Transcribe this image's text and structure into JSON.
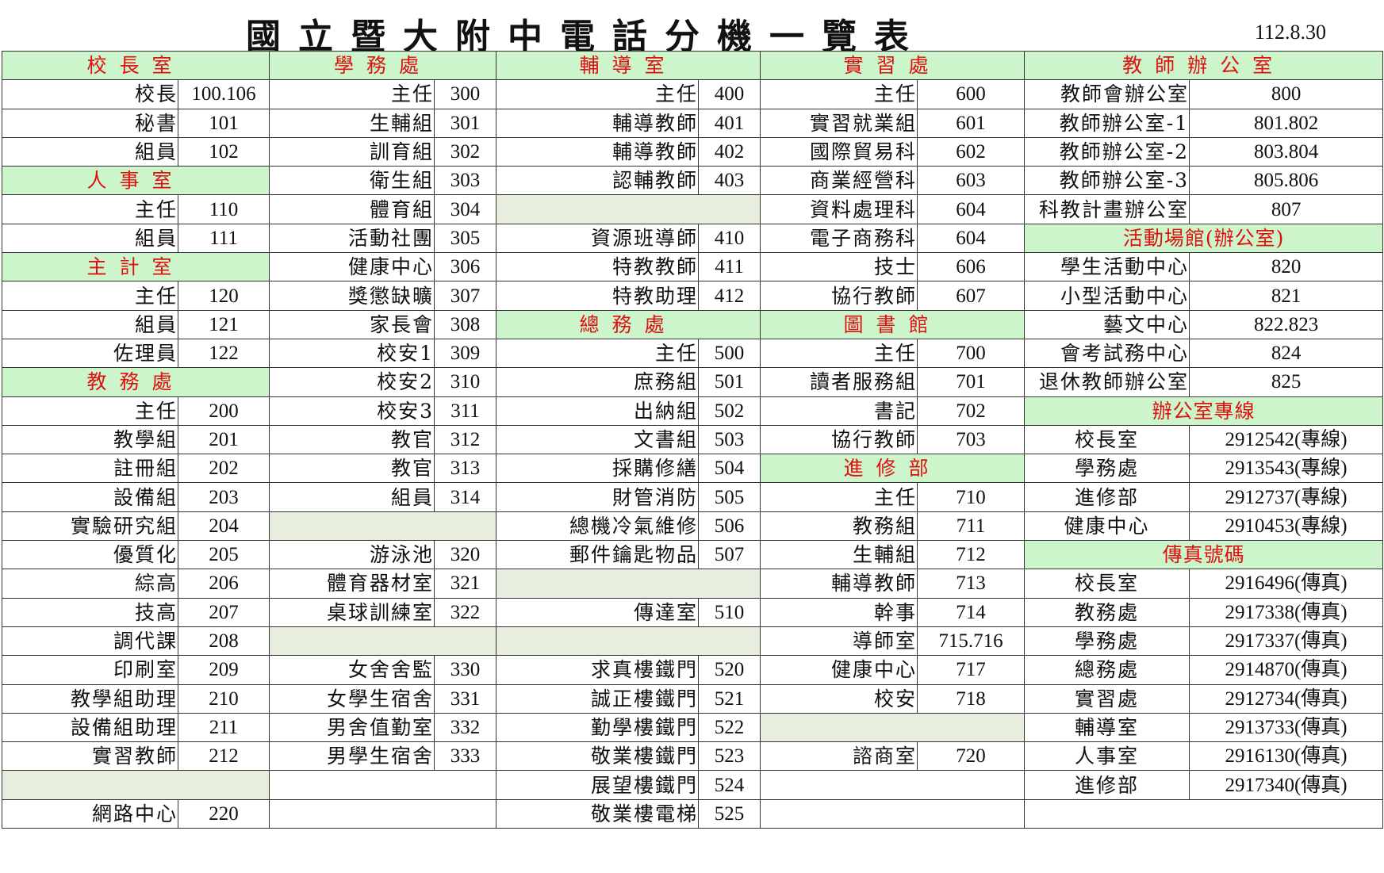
{
  "header": {
    "title": "國立暨大附中電話分機一覽表",
    "date": "112.8.30"
  },
  "rows": [
    [
      {
        "t": "h",
        "v": "校長室"
      },
      {
        "t": "h",
        "v": "學務處"
      },
      {
        "t": "h",
        "v": "輔導室"
      },
      {
        "t": "h",
        "v": "實習處"
      },
      {
        "t": "h",
        "v": "教師辦公室"
      }
    ],
    [
      {
        "t": "p",
        "l": "校長",
        "v": "100.106"
      },
      {
        "t": "p",
        "l": "主任",
        "v": "300"
      },
      {
        "t": "p",
        "l": "主任",
        "v": "400"
      },
      {
        "t": "p",
        "l": "主任",
        "v": "600"
      },
      {
        "t": "p",
        "l": "教師會辦公室",
        "v": "800"
      }
    ],
    [
      {
        "t": "p",
        "l": "秘書",
        "v": "101"
      },
      {
        "t": "p",
        "l": "生輔組",
        "v": "301"
      },
      {
        "t": "p",
        "l": "輔導教師",
        "v": "401"
      },
      {
        "t": "p",
        "l": "實習就業組",
        "v": "601"
      },
      {
        "t": "p",
        "l": "教師辦公室-1",
        "v": "801.802"
      }
    ],
    [
      {
        "t": "p",
        "l": "組員",
        "v": "102"
      },
      {
        "t": "p",
        "l": "訓育組",
        "v": "302"
      },
      {
        "t": "p",
        "l": "輔導教師",
        "v": "402"
      },
      {
        "t": "p",
        "l": "國際貿易科",
        "v": "602"
      },
      {
        "t": "p",
        "l": "教師辦公室-2",
        "v": "803.804"
      }
    ],
    [
      {
        "t": "h",
        "v": "人事室"
      },
      {
        "t": "p",
        "l": "衛生組",
        "v": "303"
      },
      {
        "t": "p",
        "l": "認輔教師",
        "v": "403"
      },
      {
        "t": "p",
        "l": "商業經營科",
        "v": "603"
      },
      {
        "t": "p",
        "l": "教師辦公室-3",
        "v": "805.806"
      }
    ],
    [
      {
        "t": "p",
        "l": "主任",
        "v": "110"
      },
      {
        "t": "p",
        "l": "體育組",
        "v": "304"
      },
      {
        "t": "b"
      },
      {
        "t": "p",
        "l": "資料處理科",
        "v": "604"
      },
      {
        "t": "p",
        "l": "科教計畫辦公室",
        "v": "807"
      }
    ],
    [
      {
        "t": "p",
        "l": "組員",
        "v": "111"
      },
      {
        "t": "p",
        "l": "活動社團",
        "v": "305"
      },
      {
        "t": "p",
        "l": "資源班導師",
        "v": "410"
      },
      {
        "t": "p",
        "l": "電子商務科",
        "v": "604"
      },
      {
        "t": "h",
        "v": "活動場館(辦公室)",
        "tight": true
      }
    ],
    [
      {
        "t": "h",
        "v": "主計室"
      },
      {
        "t": "p",
        "l": "健康中心",
        "v": "306"
      },
      {
        "t": "p",
        "l": "特教教師",
        "v": "411"
      },
      {
        "t": "p",
        "l": "技士",
        "v": "606"
      },
      {
        "t": "p",
        "l": "學生活動中心",
        "v": "820"
      }
    ],
    [
      {
        "t": "p",
        "l": "主任",
        "v": "120"
      },
      {
        "t": "p",
        "l": "獎懲缺曠",
        "v": "307"
      },
      {
        "t": "p",
        "l": "特教助理",
        "v": "412"
      },
      {
        "t": "p",
        "l": "協行教師",
        "v": "607"
      },
      {
        "t": "p",
        "l": "小型活動中心",
        "v": "821"
      }
    ],
    [
      {
        "t": "p",
        "l": "組員",
        "v": "121"
      },
      {
        "t": "p",
        "l": "家長會",
        "v": "308"
      },
      {
        "t": "h",
        "v": "總務處"
      },
      {
        "t": "h",
        "v": "圖書館"
      },
      {
        "t": "p",
        "l": "藝文中心",
        "v": "822.823"
      }
    ],
    [
      {
        "t": "p",
        "l": "佐理員",
        "v": "122"
      },
      {
        "t": "p",
        "l": "校安1",
        "v": "309"
      },
      {
        "t": "p",
        "l": "主任",
        "v": "500"
      },
      {
        "t": "p",
        "l": "主任",
        "v": "700"
      },
      {
        "t": "p",
        "l": "會考試務中心",
        "v": "824"
      }
    ],
    [
      {
        "t": "h",
        "v": "教務處"
      },
      {
        "t": "p",
        "l": "校安2",
        "v": "310"
      },
      {
        "t": "p",
        "l": "庶務組",
        "v": "501"
      },
      {
        "t": "p",
        "l": "讀者服務組",
        "v": "701"
      },
      {
        "t": "p",
        "l": "退休教師辦公室",
        "v": "825"
      }
    ],
    [
      {
        "t": "p",
        "l": "主任",
        "v": "200"
      },
      {
        "t": "p",
        "l": "校安3",
        "v": "311"
      },
      {
        "t": "p",
        "l": "出納組",
        "v": "502"
      },
      {
        "t": "p",
        "l": "書記",
        "v": "702"
      },
      {
        "t": "h",
        "v": "辦公室專線",
        "tight": true
      }
    ],
    [
      {
        "t": "p",
        "l": "教學組",
        "v": "201"
      },
      {
        "t": "p",
        "l": "教官",
        "v": "312"
      },
      {
        "t": "p",
        "l": "文書組",
        "v": "503"
      },
      {
        "t": "p",
        "l": "協行教師",
        "v": "703"
      },
      {
        "t": "p",
        "l": "校長室",
        "v": "2912542(專線)",
        "c": true
      }
    ],
    [
      {
        "t": "p",
        "l": "註冊組",
        "v": "202"
      },
      {
        "t": "p",
        "l": "教官",
        "v": "313"
      },
      {
        "t": "p",
        "l": "採購修繕",
        "v": "504"
      },
      {
        "t": "h",
        "v": "進修部"
      },
      {
        "t": "p",
        "l": "學務處",
        "v": "2913543(專線)",
        "c": true
      }
    ],
    [
      {
        "t": "p",
        "l": "設備組",
        "v": "203"
      },
      {
        "t": "p",
        "l": "組員",
        "v": "314"
      },
      {
        "t": "p",
        "l": "財管消防",
        "v": "505"
      },
      {
        "t": "p",
        "l": "主任",
        "v": "710"
      },
      {
        "t": "p",
        "l": "進修部",
        "v": "2912737(專線)",
        "c": true
      }
    ],
    [
      {
        "t": "p",
        "l": "實驗研究組",
        "v": "204"
      },
      {
        "t": "b"
      },
      {
        "t": "p",
        "l": "總機冷氣維修",
        "v": "506"
      },
      {
        "t": "p",
        "l": "教務組",
        "v": "711"
      },
      {
        "t": "p",
        "l": "健康中心",
        "v": "2910453(專線)",
        "c": true
      }
    ],
    [
      {
        "t": "p",
        "l": "優質化",
        "v": "205"
      },
      {
        "t": "p",
        "l": "游泳池",
        "v": "320"
      },
      {
        "t": "p",
        "l": "郵件鑰匙物品",
        "v": "507"
      },
      {
        "t": "p",
        "l": "生輔組",
        "v": "712"
      },
      {
        "t": "h",
        "v": "傳真號碼",
        "tight": true
      }
    ],
    [
      {
        "t": "p",
        "l": "綜高",
        "v": "206"
      },
      {
        "t": "p",
        "l": "體育器材室",
        "v": "321"
      },
      {
        "t": "b"
      },
      {
        "t": "p",
        "l": "輔導教師",
        "v": "713"
      },
      {
        "t": "p",
        "l": "校長室",
        "v": "2916496(傳真)",
        "c": true
      }
    ],
    [
      {
        "t": "p",
        "l": "技高",
        "v": "207"
      },
      {
        "t": "p",
        "l": "桌球訓練室",
        "v": "322"
      },
      {
        "t": "p",
        "l": "傳達室",
        "v": "510"
      },
      {
        "t": "p",
        "l": "幹事",
        "v": "714"
      },
      {
        "t": "p",
        "l": "教務處",
        "v": "2917338(傳真)",
        "c": true
      }
    ],
    [
      {
        "t": "p",
        "l": "調代課",
        "v": "208"
      },
      {
        "t": "b"
      },
      {
        "t": "b"
      },
      {
        "t": "p",
        "l": "導師室",
        "v": "715.716"
      },
      {
        "t": "p",
        "l": "學務處",
        "v": "2917337(傳真)",
        "c": true
      }
    ],
    [
      {
        "t": "p",
        "l": "印刷室",
        "v": "209"
      },
      {
        "t": "p",
        "l": "女舍舍監",
        "v": "330"
      },
      {
        "t": "p",
        "l": "求真樓鐵門",
        "v": "520"
      },
      {
        "t": "p",
        "l": "健康中心",
        "v": "717"
      },
      {
        "t": "p",
        "l": "總務處",
        "v": "2914870(傳真)",
        "c": true
      }
    ],
    [
      {
        "t": "p",
        "l": "教學組助理",
        "v": "210"
      },
      {
        "t": "p",
        "l": "女學生宿舍",
        "v": "331"
      },
      {
        "t": "p",
        "l": "誠正樓鐵門",
        "v": "521"
      },
      {
        "t": "p",
        "l": "校安",
        "v": "718"
      },
      {
        "t": "p",
        "l": "實習處",
        "v": "2912734(傳真)",
        "c": true
      }
    ],
    [
      {
        "t": "p",
        "l": "設備組助理",
        "v": "211"
      },
      {
        "t": "p",
        "l": "男舍值勤室",
        "v": "332"
      },
      {
        "t": "p",
        "l": "勤學樓鐵門",
        "v": "522"
      },
      {
        "t": "b"
      },
      {
        "t": "p",
        "l": "輔導室",
        "v": "2913733(傳真)",
        "c": true
      }
    ],
    [
      {
        "t": "p",
        "l": "實習教師",
        "v": "212"
      },
      {
        "t": "p",
        "l": "男學生宿舍",
        "v": "333"
      },
      {
        "t": "p",
        "l": "敬業樓鐵門",
        "v": "523"
      },
      {
        "t": "p",
        "l": "諮商室",
        "v": "720"
      },
      {
        "t": "p",
        "l": "人事室",
        "v": "2916130(傳真)",
        "c": true
      }
    ],
    [
      {
        "t": "b"
      },
      {
        "t": "e"
      },
      {
        "t": "p",
        "l": "展望樓鐵門",
        "v": "524"
      },
      {
        "t": "e"
      },
      {
        "t": "p",
        "l": "進修部",
        "v": "2917340(傳真)",
        "c": true
      }
    ],
    [
      {
        "t": "p",
        "l": "網路中心",
        "v": "220"
      },
      {
        "t": "e"
      },
      {
        "t": "p",
        "l": "敬業樓電梯",
        "v": "525"
      },
      {
        "t": "e"
      },
      {
        "t": "e"
      }
    ]
  ]
}
